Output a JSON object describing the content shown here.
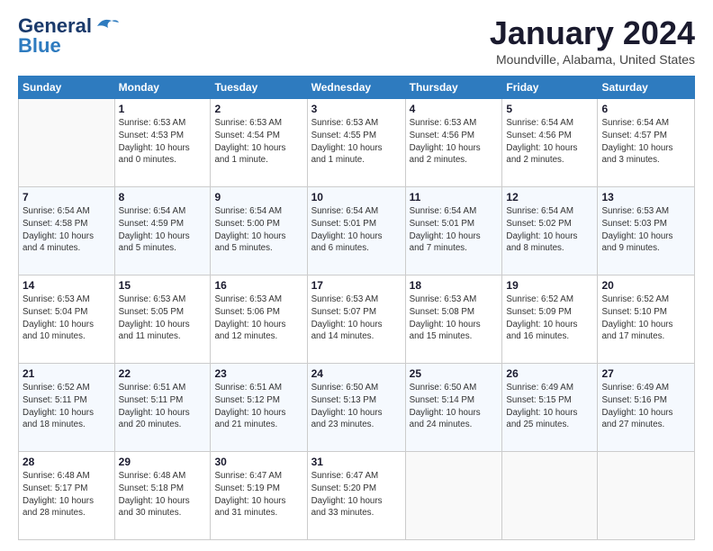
{
  "logo": {
    "line1": "General",
    "line2": "Blue"
  },
  "title": "January 2024",
  "location": "Moundville, Alabama, United States",
  "days_header": [
    "Sunday",
    "Monday",
    "Tuesday",
    "Wednesday",
    "Thursday",
    "Friday",
    "Saturday"
  ],
  "weeks": [
    [
      {
        "num": "",
        "info": ""
      },
      {
        "num": "1",
        "info": "Sunrise: 6:53 AM\nSunset: 4:53 PM\nDaylight: 10 hours\nand 0 minutes."
      },
      {
        "num": "2",
        "info": "Sunrise: 6:53 AM\nSunset: 4:54 PM\nDaylight: 10 hours\nand 1 minute."
      },
      {
        "num": "3",
        "info": "Sunrise: 6:53 AM\nSunset: 4:55 PM\nDaylight: 10 hours\nand 1 minute."
      },
      {
        "num": "4",
        "info": "Sunrise: 6:53 AM\nSunset: 4:56 PM\nDaylight: 10 hours\nand 2 minutes."
      },
      {
        "num": "5",
        "info": "Sunrise: 6:54 AM\nSunset: 4:56 PM\nDaylight: 10 hours\nand 2 minutes."
      },
      {
        "num": "6",
        "info": "Sunrise: 6:54 AM\nSunset: 4:57 PM\nDaylight: 10 hours\nand 3 minutes."
      }
    ],
    [
      {
        "num": "7",
        "info": "Sunrise: 6:54 AM\nSunset: 4:58 PM\nDaylight: 10 hours\nand 4 minutes."
      },
      {
        "num": "8",
        "info": "Sunrise: 6:54 AM\nSunset: 4:59 PM\nDaylight: 10 hours\nand 5 minutes."
      },
      {
        "num": "9",
        "info": "Sunrise: 6:54 AM\nSunset: 5:00 PM\nDaylight: 10 hours\nand 5 minutes."
      },
      {
        "num": "10",
        "info": "Sunrise: 6:54 AM\nSunset: 5:01 PM\nDaylight: 10 hours\nand 6 minutes."
      },
      {
        "num": "11",
        "info": "Sunrise: 6:54 AM\nSunset: 5:01 PM\nDaylight: 10 hours\nand 7 minutes."
      },
      {
        "num": "12",
        "info": "Sunrise: 6:54 AM\nSunset: 5:02 PM\nDaylight: 10 hours\nand 8 minutes."
      },
      {
        "num": "13",
        "info": "Sunrise: 6:53 AM\nSunset: 5:03 PM\nDaylight: 10 hours\nand 9 minutes."
      }
    ],
    [
      {
        "num": "14",
        "info": "Sunrise: 6:53 AM\nSunset: 5:04 PM\nDaylight: 10 hours\nand 10 minutes."
      },
      {
        "num": "15",
        "info": "Sunrise: 6:53 AM\nSunset: 5:05 PM\nDaylight: 10 hours\nand 11 minutes."
      },
      {
        "num": "16",
        "info": "Sunrise: 6:53 AM\nSunset: 5:06 PM\nDaylight: 10 hours\nand 12 minutes."
      },
      {
        "num": "17",
        "info": "Sunrise: 6:53 AM\nSunset: 5:07 PM\nDaylight: 10 hours\nand 14 minutes."
      },
      {
        "num": "18",
        "info": "Sunrise: 6:53 AM\nSunset: 5:08 PM\nDaylight: 10 hours\nand 15 minutes."
      },
      {
        "num": "19",
        "info": "Sunrise: 6:52 AM\nSunset: 5:09 PM\nDaylight: 10 hours\nand 16 minutes."
      },
      {
        "num": "20",
        "info": "Sunrise: 6:52 AM\nSunset: 5:10 PM\nDaylight: 10 hours\nand 17 minutes."
      }
    ],
    [
      {
        "num": "21",
        "info": "Sunrise: 6:52 AM\nSunset: 5:11 PM\nDaylight: 10 hours\nand 18 minutes."
      },
      {
        "num": "22",
        "info": "Sunrise: 6:51 AM\nSunset: 5:11 PM\nDaylight: 10 hours\nand 20 minutes."
      },
      {
        "num": "23",
        "info": "Sunrise: 6:51 AM\nSunset: 5:12 PM\nDaylight: 10 hours\nand 21 minutes."
      },
      {
        "num": "24",
        "info": "Sunrise: 6:50 AM\nSunset: 5:13 PM\nDaylight: 10 hours\nand 23 minutes."
      },
      {
        "num": "25",
        "info": "Sunrise: 6:50 AM\nSunset: 5:14 PM\nDaylight: 10 hours\nand 24 minutes."
      },
      {
        "num": "26",
        "info": "Sunrise: 6:49 AM\nSunset: 5:15 PM\nDaylight: 10 hours\nand 25 minutes."
      },
      {
        "num": "27",
        "info": "Sunrise: 6:49 AM\nSunset: 5:16 PM\nDaylight: 10 hours\nand 27 minutes."
      }
    ],
    [
      {
        "num": "28",
        "info": "Sunrise: 6:48 AM\nSunset: 5:17 PM\nDaylight: 10 hours\nand 28 minutes."
      },
      {
        "num": "29",
        "info": "Sunrise: 6:48 AM\nSunset: 5:18 PM\nDaylight: 10 hours\nand 30 minutes."
      },
      {
        "num": "30",
        "info": "Sunrise: 6:47 AM\nSunset: 5:19 PM\nDaylight: 10 hours\nand 31 minutes."
      },
      {
        "num": "31",
        "info": "Sunrise: 6:47 AM\nSunset: 5:20 PM\nDaylight: 10 hours\nand 33 minutes."
      },
      {
        "num": "",
        "info": ""
      },
      {
        "num": "",
        "info": ""
      },
      {
        "num": "",
        "info": ""
      }
    ]
  ]
}
